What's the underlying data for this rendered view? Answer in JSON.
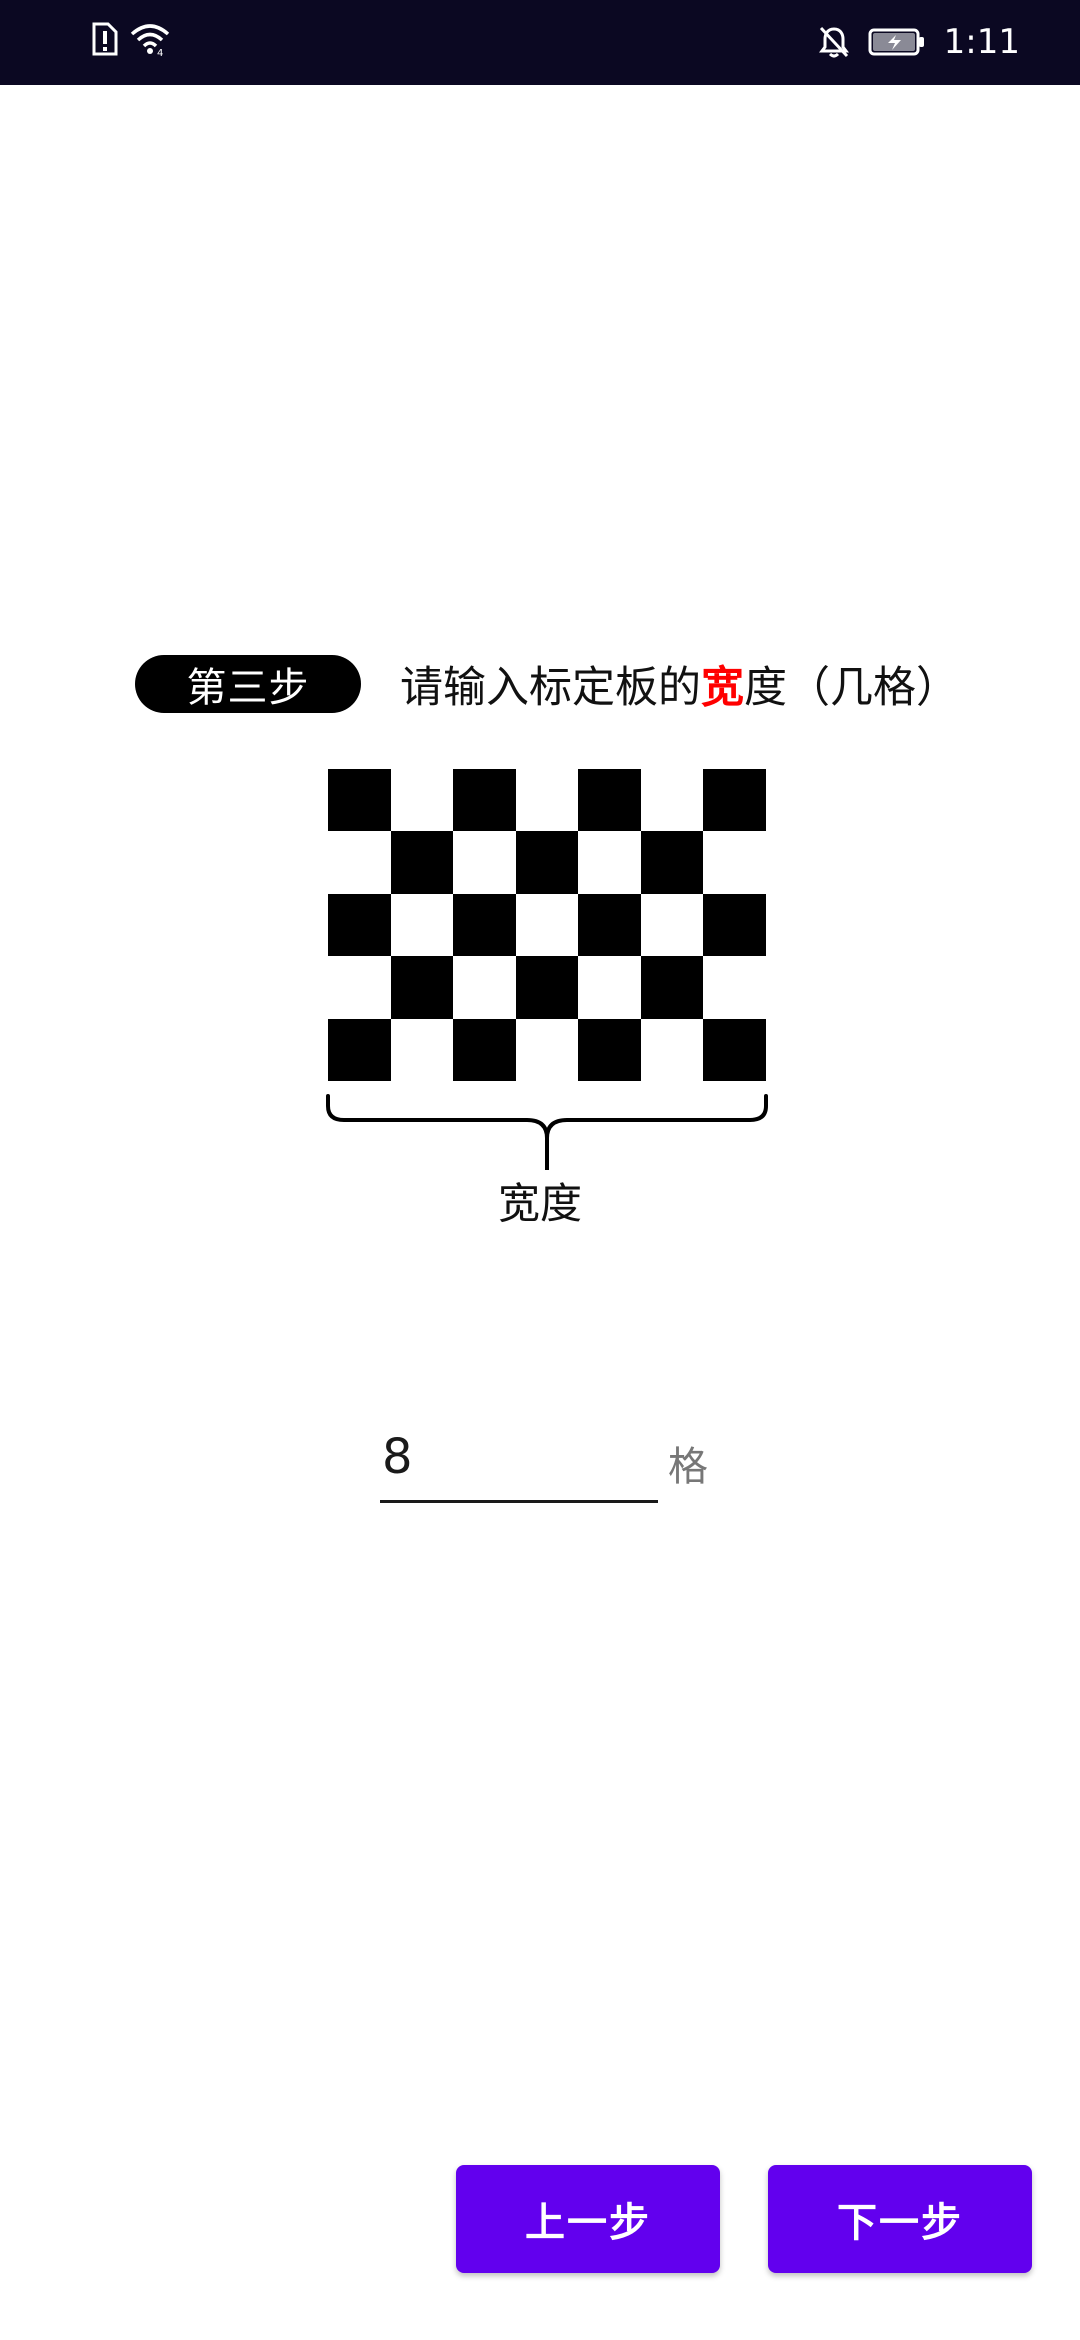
{
  "status_bar": {
    "time": "1:11",
    "icons": [
      "sim-alert-icon",
      "wifi-icon",
      "bell-off-icon",
      "battery-charging-icon"
    ]
  },
  "step": {
    "badge": "第三步",
    "instruction_before": "请输入标定板的",
    "instruction_highlight": "宽",
    "instruction_after": "度（几格）",
    "highlight_color": "#ff0000"
  },
  "illustration": {
    "width_label": "宽度"
  },
  "input": {
    "value": "8",
    "unit": "格"
  },
  "buttons": {
    "prev": "上一步",
    "next": "下一步",
    "color": "#6200ee"
  }
}
